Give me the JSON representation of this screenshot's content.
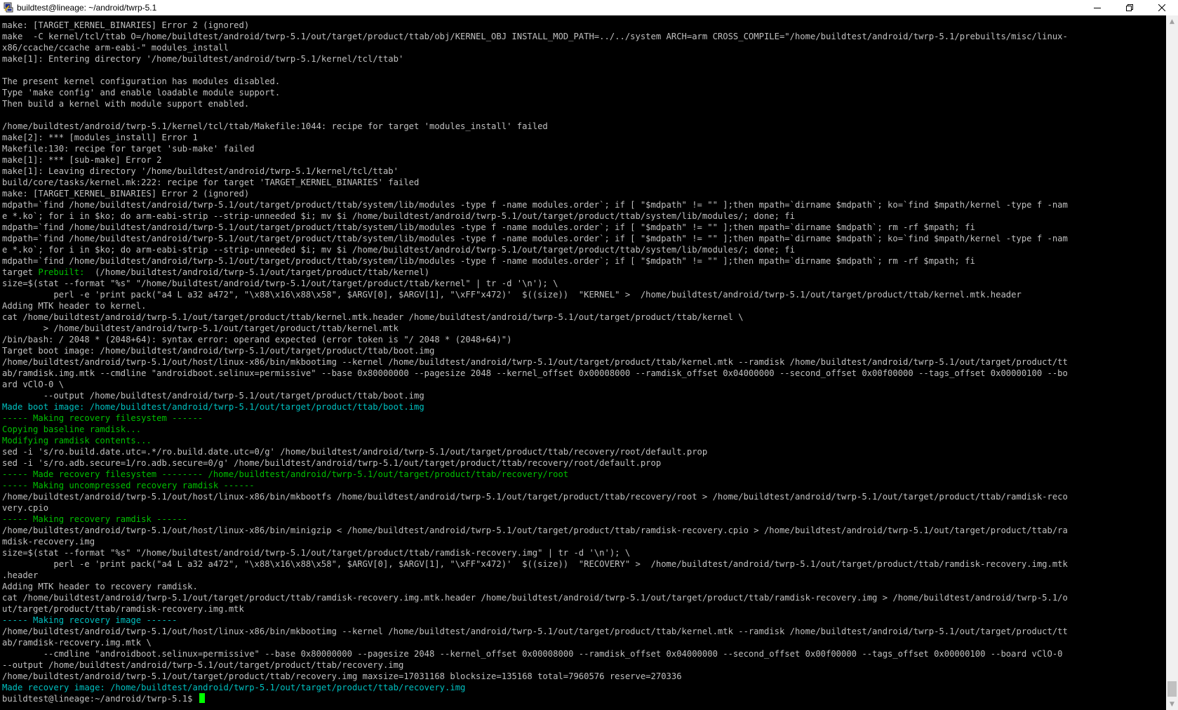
{
  "window": {
    "title": "buildtest@lineage: ~/android/twrp-5.1"
  },
  "colors": {
    "default_text": "#c0c0c0",
    "green": "#00c000",
    "cyan": "#00c0c0",
    "cursor": "#00ff00",
    "background": "#000000"
  },
  "icons": {
    "app": "putty-icon",
    "minimize": "minimize-icon",
    "maximize": "maximize-icon",
    "close": "close-icon",
    "scroll_up": "scroll-up-arrow-icon",
    "scroll_down": "scroll-down-arrow-icon"
  },
  "scrollbar": {
    "thumb_position": "bottom"
  },
  "terminal": {
    "lines": [
      {
        "segments": [
          {
            "t": "make: [TARGET_KERNEL_BINARIES] Error 2 (ignored)"
          }
        ]
      },
      {
        "segments": [
          {
            "t": "make  -C kernel/tcl/ttab O=/home/buildtest/android/twrp-5.1/out/target/product/ttab/obj/KERNEL_OBJ INSTALL_MOD_PATH=../../system ARCH=arm CROSS_COMPILE=\"/home/buildtest/android/twrp-5.1/prebuilts/misc/linux-"
          }
        ]
      },
      {
        "segments": [
          {
            "t": "x86/ccache/ccache arm-eabi-\" modules_install"
          }
        ]
      },
      {
        "segments": [
          {
            "t": "make[1]: Entering directory '/home/buildtest/android/twrp-5.1/kernel/tcl/ttab'"
          }
        ]
      },
      {
        "segments": [
          {
            "t": ""
          }
        ]
      },
      {
        "segments": [
          {
            "t": "The present kernel configuration has modules disabled."
          }
        ]
      },
      {
        "segments": [
          {
            "t": "Type 'make config' and enable loadable module support."
          }
        ]
      },
      {
        "segments": [
          {
            "t": "Then build a kernel with module support enabled."
          }
        ]
      },
      {
        "segments": [
          {
            "t": ""
          }
        ]
      },
      {
        "segments": [
          {
            "t": "/home/buildtest/android/twrp-5.1/kernel/tcl/ttab/Makefile:1044: recipe for target 'modules_install' failed"
          }
        ]
      },
      {
        "segments": [
          {
            "t": "make[2]: *** [modules_install] Error 1"
          }
        ]
      },
      {
        "segments": [
          {
            "t": "Makefile:130: recipe for target 'sub-make' failed"
          }
        ]
      },
      {
        "segments": [
          {
            "t": "make[1]: *** [sub-make] Error 2"
          }
        ]
      },
      {
        "segments": [
          {
            "t": "make[1]: Leaving directory '/home/buildtest/android/twrp-5.1/kernel/tcl/ttab'"
          }
        ]
      },
      {
        "segments": [
          {
            "t": "build/core/tasks/kernel.mk:222: recipe for target 'TARGET_KERNEL_BINARIES' failed"
          }
        ]
      },
      {
        "segments": [
          {
            "t": "make: [TARGET_KERNEL_BINARIES] Error 2 (ignored)"
          }
        ]
      },
      {
        "segments": [
          {
            "t": "mdpath=`find /home/buildtest/android/twrp-5.1/out/target/product/ttab/system/lib/modules -type f -name modules.order`; if [ \"$mdpath\" != \"\" ];then mpath=`dirname $mdpath`; ko=`find $mpath/kernel -type f -nam"
          }
        ]
      },
      {
        "segments": [
          {
            "t": "e *.ko`; for i in $ko; do arm-eabi-strip --strip-unneeded $i; mv $i /home/buildtest/android/twrp-5.1/out/target/product/ttab/system/lib/modules/; done; fi"
          }
        ]
      },
      {
        "segments": [
          {
            "t": "mdpath=`find /home/buildtest/android/twrp-5.1/out/target/product/ttab/system/lib/modules -type f -name modules.order`; if [ \"$mdpath\" != \"\" ];then mpath=`dirname $mdpath`; rm -rf $mpath; fi"
          }
        ]
      },
      {
        "segments": [
          {
            "t": "mdpath=`find /home/buildtest/android/twrp-5.1/out/target/product/ttab/system/lib/modules -type f -name modules.order`; if [ \"$mdpath\" != \"\" ];then mpath=`dirname $mdpath`; ko=`find $mpath/kernel -type f -nam"
          }
        ]
      },
      {
        "segments": [
          {
            "t": "e *.ko`; for i in $ko; do arm-eabi-strip --strip-unneeded $i; mv $i /home/buildtest/android/twrp-5.1/out/target/product/ttab/system/lib/modules/; done; fi"
          }
        ]
      },
      {
        "segments": [
          {
            "t": "mdpath=`find /home/buildtest/android/twrp-5.1/out/target/product/ttab/system/lib/modules -type f -name modules.order`; if [ \"$mdpath\" != \"\" ];then mpath=`dirname $mdpath`; rm -rf $mpath; fi"
          }
        ]
      },
      {
        "segments": [
          {
            "t": "target "
          },
          {
            "t": "Prebuilt:",
            "c": "green"
          },
          {
            "t": "  (/home/buildtest/android/twrp-5.1/out/target/product/ttab/kernel)"
          }
        ]
      },
      {
        "segments": [
          {
            "t": "size=$(stat --format \"%s\" \"/home/buildtest/android/twrp-5.1/out/target/product/ttab/kernel\" | tr -d '\\n'); \\"
          }
        ]
      },
      {
        "segments": [
          {
            "t": "          perl -e 'print pack(\"a4 L a32 a472\", \"\\x88\\x16\\x88\\x58\", $ARGV[0], $ARGV[1], \"\\xFF\"x472)'  $((size))  \"KERNEL\" >  /home/buildtest/android/twrp-5.1/out/target/product/ttab/kernel.mtk.header"
          }
        ]
      },
      {
        "segments": [
          {
            "t": "Adding MTK header to kernel."
          }
        ]
      },
      {
        "segments": [
          {
            "t": "cat /home/buildtest/android/twrp-5.1/out/target/product/ttab/kernel.mtk.header /home/buildtest/android/twrp-5.1/out/target/product/ttab/kernel \\"
          }
        ]
      },
      {
        "segments": [
          {
            "t": "        > /home/buildtest/android/twrp-5.1/out/target/product/ttab/kernel.mtk"
          }
        ]
      },
      {
        "segments": [
          {
            "t": "/bin/bash: / 2048 * (2048+64): syntax error: operand expected (error token is \"/ 2048 * (2048+64)\")"
          }
        ]
      },
      {
        "segments": [
          {
            "t": "Target boot image: /home/buildtest/android/twrp-5.1/out/target/product/ttab/boot.img"
          }
        ]
      },
      {
        "segments": [
          {
            "t": "/home/buildtest/android/twrp-5.1/out/host/linux-x86/bin/mkbootimg --kernel /home/buildtest/android/twrp-5.1/out/target/product/ttab/kernel.mtk --ramdisk /home/buildtest/android/twrp-5.1/out/target/product/tt"
          }
        ]
      },
      {
        "segments": [
          {
            "t": "ab/ramdisk.img.mtk --cmdline \"androidboot.selinux=permissive\" --base 0x80000000 --pagesize 2048 --kernel_offset 0x00008000 --ramdisk_offset 0x04000000 --second_offset 0x00f00000 --tags_offset 0x00000100 --bo"
          }
        ]
      },
      {
        "segments": [
          {
            "t": "ard vClO-0 \\"
          }
        ]
      },
      {
        "segments": [
          {
            "t": "        --output /home/buildtest/android/twrp-5.1/out/target/product/ttab/boot.img"
          }
        ]
      },
      {
        "segments": [
          {
            "t": "Made boot image: /home/buildtest/android/twrp-5.1/out/target/product/ttab/boot.img",
            "c": "cyan"
          }
        ]
      },
      {
        "segments": [
          {
            "t": "----- Making recovery filesystem ------",
            "c": "green"
          }
        ]
      },
      {
        "segments": [
          {
            "t": "Copying baseline ramdisk...",
            "c": "green"
          }
        ]
      },
      {
        "segments": [
          {
            "t": "Modifying ramdisk contents...",
            "c": "green"
          }
        ]
      },
      {
        "segments": [
          {
            "t": "sed -i 's/ro.build.date.utc=.*/ro.build.date.utc=0/g' /home/buildtest/android/twrp-5.1/out/target/product/ttab/recovery/root/default.prop"
          }
        ]
      },
      {
        "segments": [
          {
            "t": "sed -i 's/ro.adb.secure=1/ro.adb.secure=0/g' /home/buildtest/android/twrp-5.1/out/target/product/ttab/recovery/root/default.prop"
          }
        ]
      },
      {
        "segments": [
          {
            "t": "----- Made recovery filesystem -------- /home/buildtest/android/twrp-5.1/out/target/product/ttab/recovery/root",
            "c": "green"
          }
        ]
      },
      {
        "segments": [
          {
            "t": "----- Making uncompressed recovery ramdisk ------",
            "c": "green"
          }
        ]
      },
      {
        "segments": [
          {
            "t": "/home/buildtest/android/twrp-5.1/out/host/linux-x86/bin/mkbootfs /home/buildtest/android/twrp-5.1/out/target/product/ttab/recovery/root > /home/buildtest/android/twrp-5.1/out/target/product/ttab/ramdisk-reco"
          }
        ]
      },
      {
        "segments": [
          {
            "t": "very.cpio"
          }
        ]
      },
      {
        "segments": [
          {
            "t": "----- Making recovery ramdisk ------",
            "c": "green"
          }
        ]
      },
      {
        "segments": [
          {
            "t": "/home/buildtest/android/twrp-5.1/out/host/linux-x86/bin/minigzip < /home/buildtest/android/twrp-5.1/out/target/product/ttab/ramdisk-recovery.cpio > /home/buildtest/android/twrp-5.1/out/target/product/ttab/ra"
          }
        ]
      },
      {
        "segments": [
          {
            "t": "mdisk-recovery.img"
          }
        ]
      },
      {
        "segments": [
          {
            "t": "size=$(stat --format \"%s\" \"/home/buildtest/android/twrp-5.1/out/target/product/ttab/ramdisk-recovery.img\" | tr -d '\\n'); \\"
          }
        ]
      },
      {
        "segments": [
          {
            "t": "          perl -e 'print pack(\"a4 L a32 a472\", \"\\x88\\x16\\x88\\x58\", $ARGV[0], $ARGV[1], \"\\xFF\"x472)'  $((size))  \"RECOVERY\" >  /home/buildtest/android/twrp-5.1/out/target/product/ttab/ramdisk-recovery.img.mtk"
          }
        ]
      },
      {
        "segments": [
          {
            "t": ".header"
          }
        ]
      },
      {
        "segments": [
          {
            "t": "Adding MTK header to recovery ramdisk."
          }
        ]
      },
      {
        "segments": [
          {
            "t": "cat /home/buildtest/android/twrp-5.1/out/target/product/ttab/ramdisk-recovery.img.mtk.header /home/buildtest/android/twrp-5.1/out/target/product/ttab/ramdisk-recovery.img > /home/buildtest/android/twrp-5.1/o"
          }
        ]
      },
      {
        "segments": [
          {
            "t": "ut/target/product/ttab/ramdisk-recovery.img.mtk"
          }
        ]
      },
      {
        "segments": [
          {
            "t": "----- Making recovery image ------",
            "c": "cyan"
          }
        ]
      },
      {
        "segments": [
          {
            "t": "/home/buildtest/android/twrp-5.1/out/host/linux-x86/bin/mkbootimg --kernel /home/buildtest/android/twrp-5.1/out/target/product/ttab/kernel.mtk --ramdisk /home/buildtest/android/twrp-5.1/out/target/product/tt"
          }
        ]
      },
      {
        "segments": [
          {
            "t": "ab/ramdisk-recovery.img.mtk \\"
          }
        ]
      },
      {
        "segments": [
          {
            "t": "        --cmdline \"androidboot.selinux=permissive\" --base 0x80000000 --pagesize 2048 --kernel_offset 0x00008000 --ramdisk_offset 0x04000000 --second_offset 0x00f00000 --tags_offset 0x00000100 --board vClO-0"
          }
        ]
      },
      {
        "segments": [
          {
            "t": "--output /home/buildtest/android/twrp-5.1/out/target/product/ttab/recovery.img"
          }
        ]
      },
      {
        "segments": [
          {
            "t": "/home/buildtest/android/twrp-5.1/out/target/product/ttab/recovery.img maxsize=17031168 blocksize=135168 total=7960576 reserve=270336"
          }
        ]
      },
      {
        "segments": [
          {
            "t": "Made recovery image: /home/buildtest/android/twrp-5.1/out/target/product/ttab/recovery.img",
            "c": "cyan"
          }
        ]
      },
      {
        "segments": [
          {
            "t": "buildtest@lineage:~/android/twrp-5.1$ "
          }
        ],
        "cursor": true
      }
    ]
  }
}
